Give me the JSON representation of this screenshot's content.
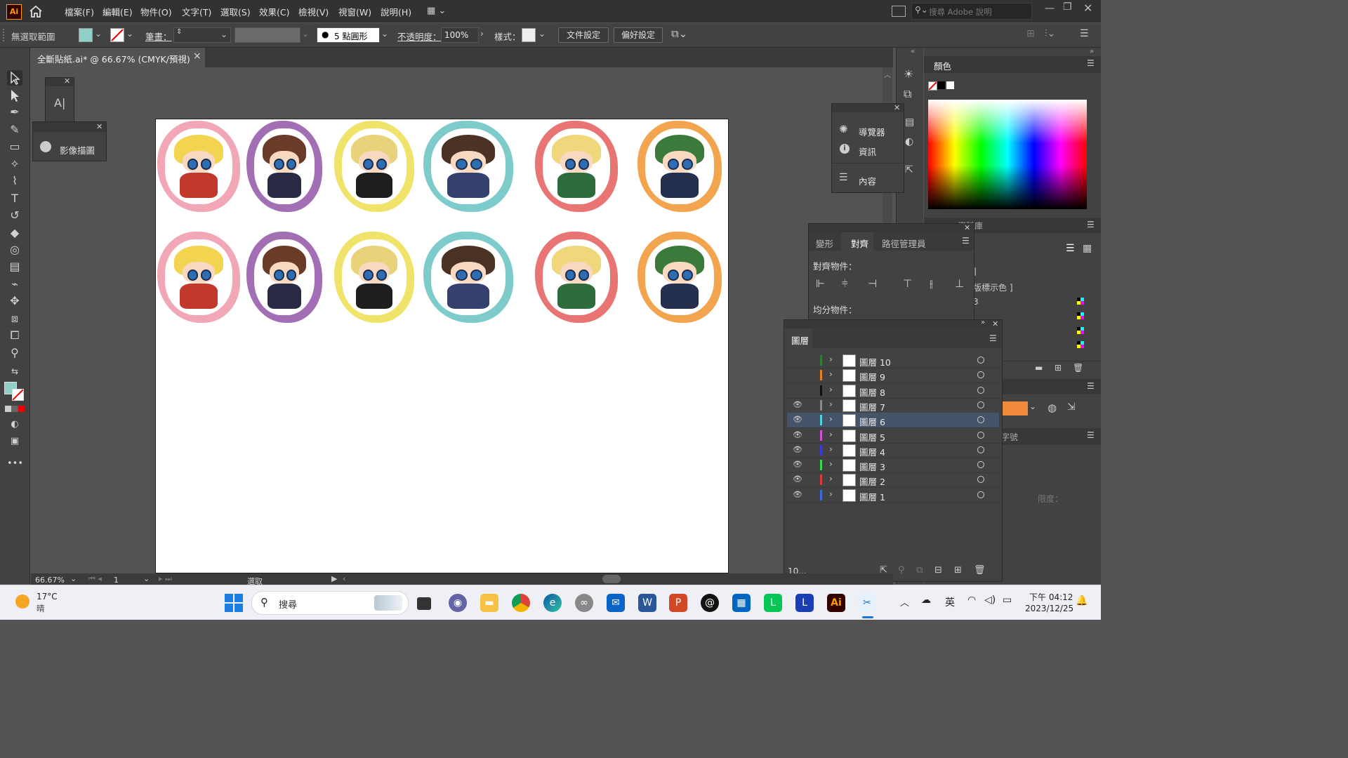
{
  "app": {
    "logo_text": "Ai"
  },
  "menu": [
    "檔案(F)",
    "編輯(E)",
    "物件(O)",
    "文字(T)",
    "選取(S)",
    "效果(C)",
    "檢視(V)",
    "視窗(W)",
    "說明(H)"
  ],
  "search": {
    "placeholder": "搜尋 Adobe 說明"
  },
  "control": {
    "selection": "無選取範圍",
    "stroke_label": "筆畫：",
    "brush": "5 點圓形",
    "opacity_label": "不透明度：",
    "opacity_value": "100%",
    "style_label": "樣式：",
    "doc_setup": "文件設定",
    "prefs": "偏好設定"
  },
  "doc_tab": {
    "title": "全斷貼紙.ai* @ 66.67% (CMYK/預視)",
    "close": "×"
  },
  "image_trace_panel": {
    "label": "影像描圖"
  },
  "nav_panel": {
    "items": [
      "導覽器",
      "資訊",
      "內容"
    ]
  },
  "align_panel": {
    "tabs": [
      "變形",
      "對齊",
      "路徑管理員"
    ],
    "align_objects": "對齊物件：",
    "distribute_objects": "均分物件："
  },
  "layers_panel": {
    "title": "圖層",
    "footer_count": "10...",
    "layers": [
      {
        "name": "圖層 10",
        "color": "#2e7d32",
        "visible": false
      },
      {
        "name": "圖層 9",
        "color": "#e67e22",
        "visible": false
      },
      {
        "name": "圖層 8",
        "color": "#111111",
        "visible": false
      },
      {
        "name": "圖層 7",
        "color": "#888888",
        "visible": true
      },
      {
        "name": "圖層 6",
        "color": "#4fd1d9",
        "visible": true,
        "selected": true
      },
      {
        "name": "圖層 5",
        "color": "#d24fd9",
        "visible": true
      },
      {
        "name": "圖層 4",
        "color": "#3a3ad9",
        "visible": true
      },
      {
        "name": "圖層 3",
        "color": "#3ad94f",
        "visible": true
      },
      {
        "name": "圖層 2",
        "color": "#d93a3a",
        "visible": true
      },
      {
        "name": "圖層 1",
        "color": "#3a6ad9",
        "visible": true
      }
    ]
  },
  "color_panel": {
    "title": "顏色"
  },
  "swatches_partial": {
    "tab": "資料庫",
    "label_1": "]",
    "label_2": "版標示色 ]",
    "label_3": "3"
  },
  "right_partial": {
    "tab_label": "字號",
    "lbl_lim": "限度："
  },
  "status": {
    "zoom": "66.67%",
    "page": "1",
    "tool": "選取"
  },
  "taskbar": {
    "weather_temp": "17°C",
    "weather_desc": "晴",
    "search": "搜尋",
    "ime": "英",
    "time": "下午 04:12",
    "date": "2023/12/25"
  },
  "stickers": [
    {
      "border": "#f2a7b6",
      "hair": "#f3d451",
      "body": "#c0392b"
    },
    {
      "border": "#a36fb4",
      "hair": "#6b3b2a",
      "body": "#2a2a44"
    },
    {
      "border": "#f0e36a",
      "hair": "#ead27a",
      "body": "#1e1e1e"
    },
    {
      "border": "#7ecbcb",
      "hair": "#4a3324",
      "body": "#35406e"
    },
    {
      "border": "#e87474",
      "hair": "#f0d77c",
      "body": "#2e6b3d"
    },
    {
      "border": "#f3a44e",
      "hair": "#3b7a3a",
      "body": "#24304e"
    }
  ]
}
